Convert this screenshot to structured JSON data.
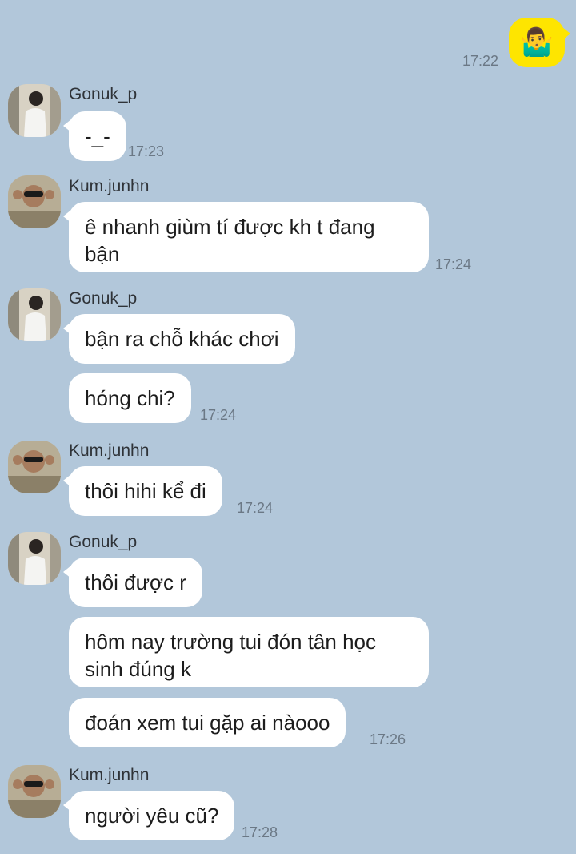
{
  "chat": {
    "me": {
      "emoji": "🤷‍♂️",
      "time": "17:22",
      "emoji_name": "person-shrugging-icon"
    },
    "messages": [
      {
        "sender": "Gonuk_p",
        "texts": [
          "-_-"
        ],
        "time": "17:23"
      },
      {
        "sender": "Kum.junhn",
        "texts": [
          "ê nhanh giùm tí được kh t đang bận"
        ],
        "time": "17:24"
      },
      {
        "sender": "Gonuk_p",
        "texts": [
          "bận ra chỗ khác chơi",
          "hóng chi?"
        ],
        "time": "17:24"
      },
      {
        "sender": "Kum.junhn",
        "texts": [
          "thôi hihi kể đi"
        ],
        "time": "17:24"
      },
      {
        "sender": "Gonuk_p",
        "texts": [
          "thôi được r",
          "hôm nay trường tui đón tân học sinh đúng k",
          "đoán xem tui gặp ai nàooo"
        ],
        "time": "17:26"
      },
      {
        "sender": "Kum.junhn",
        "texts": [
          "người yêu cũ?"
        ],
        "time": "17:28"
      }
    ]
  },
  "colors": {
    "background": "#b2c7da",
    "incoming_bubble": "#ffffff",
    "outgoing_bubble": "#fee500",
    "timestamp": "#6b7885"
  }
}
